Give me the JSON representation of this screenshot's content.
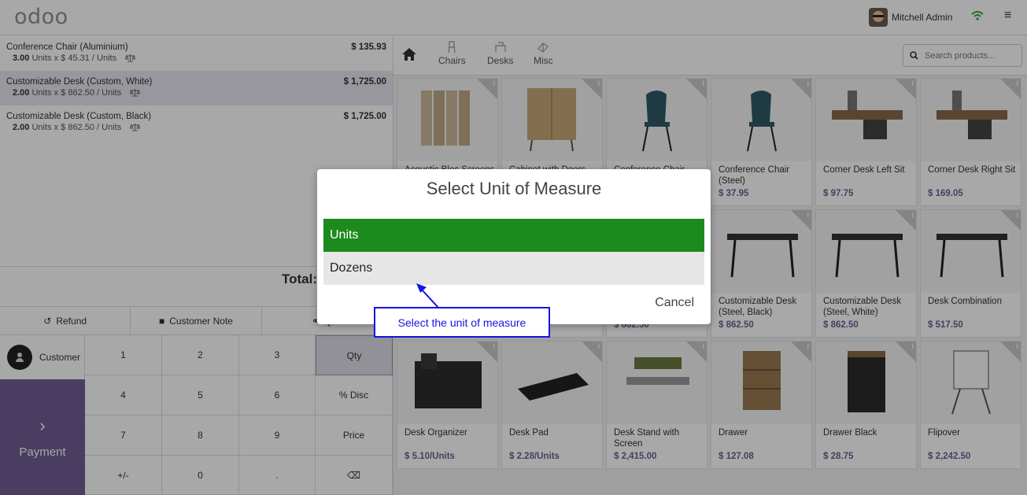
{
  "header": {
    "logo": "odoo",
    "user_name": "Mitchell Admin"
  },
  "order": {
    "lines": [
      {
        "name": "Conference Chair (Aluminium)",
        "price": "$ 135.93",
        "qty": "3.00",
        "unit_info": "Units x $ 45.31 / Units",
        "selected": false
      },
      {
        "name": "Customizable Desk (Custom, White)",
        "price": "$ 1,725.00",
        "qty": "2.00",
        "unit_info": "Units x $ 862.50 / Units",
        "selected": true
      },
      {
        "name": "Customizable Desk (Custom, Black)",
        "price": "$ 1,725.00",
        "qty": "2.00",
        "unit_info": "Units x $ 862.50 / Units",
        "selected": false
      }
    ],
    "total_label": "Total:"
  },
  "actions": {
    "refund": "Refund",
    "customer_note": "Customer Note",
    "quotation": "Quo"
  },
  "pad": {
    "customer": "Customer",
    "payment": "Payment",
    "keys": [
      "1",
      "2",
      "3",
      "Qty",
      "4",
      "5",
      "6",
      "% Disc",
      "7",
      "8",
      "9",
      "Price",
      "+/-",
      "0",
      ".",
      "⌫"
    ]
  },
  "categories": [
    "Chairs",
    "Desks",
    "Misc"
  ],
  "search": {
    "placeholder": "Search products..."
  },
  "products": [
    {
      "name": "Acoustic Bloc Screens",
      "price": ""
    },
    {
      "name": "Cabinet with Doors",
      "price": ""
    },
    {
      "name": "Conference Chair",
      "price": ""
    },
    {
      "name": "Conference Chair (Steel)",
      "price": "$ 37.95"
    },
    {
      "name": "Corner Desk Left Sit",
      "price": "$ 97.75"
    },
    {
      "name": "Corner Desk Right Sit",
      "price": "$ 169.05"
    },
    {
      "name": "",
      "price": ""
    },
    {
      "name": "",
      "price": ""
    },
    {
      "name": "",
      "price": "$ 862.50"
    },
    {
      "name": "Customizable Desk (Steel, Black)",
      "price": "$ 862.50"
    },
    {
      "name": "Customizable Desk (Steel, White)",
      "price": "$ 862.50"
    },
    {
      "name": "Desk Combination",
      "price": "$ 517.50"
    },
    {
      "name": "Desk Organizer",
      "price": "$ 5.10/Units"
    },
    {
      "name": "Desk Pad",
      "price": "$ 2.28/Units"
    },
    {
      "name": "Desk Stand with Screen",
      "price": "$ 2,415.00"
    },
    {
      "name": "Drawer",
      "price": "$ 127.08"
    },
    {
      "name": "Drawer Black",
      "price": "$ 28.75"
    },
    {
      "name": "Flipover",
      "price": "$ 2,242.50"
    }
  ],
  "modal": {
    "title": "Select Unit of Measure",
    "options": [
      "Units",
      "Dozens"
    ],
    "selected": "Units",
    "cancel": "Cancel"
  },
  "annotation": {
    "text": "Select the unit of measure"
  },
  "colors": {
    "accent": "#6f5d94",
    "selected_uom": "#1c8a1c",
    "annotation": "#1414e6"
  }
}
